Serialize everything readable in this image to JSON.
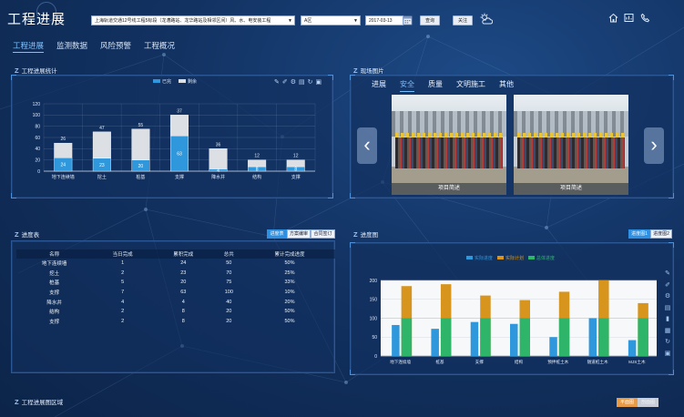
{
  "header": {
    "title": "工程进展",
    "project_select": "上海轨道交通12号线工程5标段（龙漕路站、龙华路站及相邻区间）风、水、电安装工程",
    "area_select": "A区",
    "date": "2017-03-13",
    "query_label": "查询",
    "follow_label": "关注",
    "icons": [
      "home-icon",
      "chart-icon",
      "phone-icon",
      "weather-icon",
      "calendar-icon"
    ]
  },
  "tabs": [
    {
      "label": "工程进展",
      "active": true
    },
    {
      "label": "监测数据",
      "active": false
    },
    {
      "label": "风险预警",
      "active": false
    },
    {
      "label": "工程概况",
      "active": false
    }
  ],
  "stats": {
    "title": "工程进展统计",
    "tools": [
      "pencil-icon",
      "brush-icon",
      "settings-icon",
      "delete-icon",
      "refresh-icon",
      "save-icon"
    ],
    "chart_data": {
      "type": "bar",
      "stacked": true,
      "categories": [
        "地下连续墙",
        "挖土",
        "桩基",
        "支撑",
        "降水井",
        "结构",
        "支撑"
      ],
      "series": [
        {
          "name": "已完",
          "values": [
            24,
            23,
            20,
            63,
            4,
            8,
            8
          ],
          "color": "#2f98dc"
        },
        {
          "name": "剩余",
          "values": [
            26,
            47,
            55,
            37,
            36,
            12,
            12
          ],
          "color": "#dcdfe4"
        }
      ],
      "ylim": [
        0,
        120
      ],
      "yticks": [
        0,
        20,
        40,
        60,
        80,
        100,
        120
      ],
      "legend": "top-center",
      "grid": true
    }
  },
  "photos": {
    "title": "现场图片",
    "tabs": [
      {
        "label": "进展",
        "active": false
      },
      {
        "label": "安全",
        "active": true
      },
      {
        "label": "质量",
        "active": false
      },
      {
        "label": "文明施工",
        "active": false
      },
      {
        "label": "其他",
        "active": false
      }
    ],
    "items": [
      {
        "caption": "项目简述"
      },
      {
        "caption": "项目简述"
      }
    ]
  },
  "progress_table": {
    "title": "进度表",
    "buttons": [
      {
        "label": "进度表",
        "active": true
      },
      {
        "label": "方案编审",
        "active": false
      },
      {
        "label": "合同签订",
        "active": false
      }
    ],
    "columns": [
      "名称",
      "当日完成",
      "累积完成",
      "总共",
      "累计完成进度"
    ],
    "rows": [
      [
        "地下连续墙",
        "1",
        "24",
        "50",
        "50%"
      ],
      [
        "挖土",
        "2",
        "23",
        "70",
        "25%"
      ],
      [
        "桩基",
        "5",
        "20",
        "75",
        "33%"
      ],
      [
        "支撑",
        "7",
        "63",
        "100",
        "10%"
      ],
      [
        "降水井",
        "4",
        "4",
        "40",
        "20%"
      ],
      [
        "结构",
        "2",
        "8",
        "20",
        "50%"
      ],
      [
        "支撑",
        "2",
        "8",
        "20",
        "50%"
      ]
    ]
  },
  "progress_chart": {
    "title": "进度图",
    "buttons": [
      {
        "label": "进度图1",
        "active": true
      },
      {
        "label": "进度图2",
        "active": false
      }
    ],
    "chart_data": {
      "type": "bar",
      "categories": [
        "地下连续墙",
        "桩基",
        "支撑",
        "结构",
        "预拌桩土木",
        "隧道桩土木",
        "MJS土木"
      ],
      "series": [
        {
          "name": "实际进度",
          "values": [
            82,
            72,
            90,
            85,
            50,
            100,
            42
          ],
          "color": "#2f98dc"
        },
        {
          "name": "实际计划",
          "values": [
            185,
            190,
            160,
            148,
            170,
            200,
            140
          ],
          "color": "#d7951e"
        },
        {
          "name": "总体进度",
          "values": [
            100,
            100,
            100,
            100,
            100,
            100,
            100
          ],
          "color": "#2eb56a"
        }
      ],
      "ylim": [
        0,
        200
      ],
      "yticks": [
        0,
        50,
        100,
        150,
        200
      ],
      "legend": "top-center",
      "grid": true
    }
  },
  "progress_area": {
    "title": "工程进展图区域",
    "buttons": [
      {
        "label": "平面图",
        "active": true
      },
      {
        "label": "剖面图",
        "active": false
      }
    ]
  }
}
